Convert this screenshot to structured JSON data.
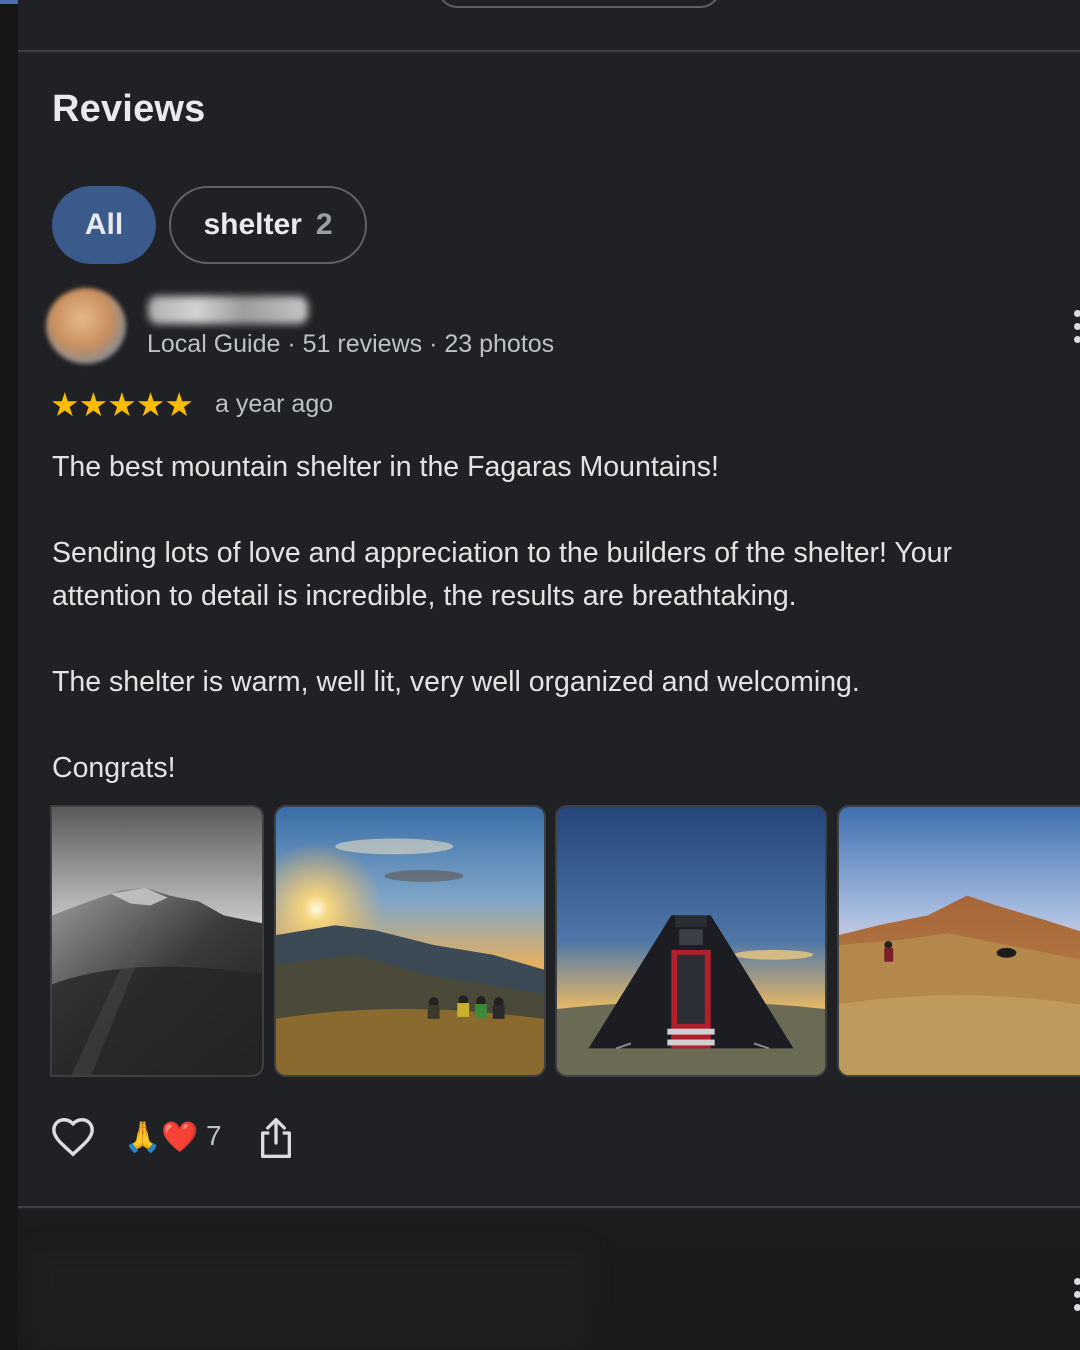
{
  "section": {
    "title": "Reviews"
  },
  "filters": [
    {
      "label": "All",
      "count": ""
    },
    {
      "label": "shelter",
      "count": "2"
    }
  ],
  "review": {
    "author_name": "",
    "author_meta": "Local Guide · 51 reviews · 23 photos",
    "rating": 5,
    "stars_text": "★★★★★",
    "time": "a year ago",
    "paragraphs": [
      "The best mountain shelter in the Fagaras Mountains!",
      "Sending lots of love and appreciation to the builders of the shelter! Your attention to detail is incredible, the results are breathtaking.",
      "The shelter is warm, well lit, very well organized and welcoming.",
      "Congrats!"
    ],
    "photos": [
      "black-and-white mountain ridge",
      "sunset over mountains with hikers",
      "triangular black shelter hut",
      "hikers on grassy mountain slope"
    ],
    "reaction_emojis": "🙏❤️",
    "reaction_count": "7"
  },
  "icons": {
    "like": "heart-outline-icon",
    "share": "share-icon",
    "more": "more-vertical-icon"
  },
  "colors": {
    "background": "#202124",
    "chip_selected": "#3a5a8c",
    "star": "#fbbc04",
    "text_primary": "#e3e3e3",
    "text_secondary": "#bdc1c6"
  }
}
